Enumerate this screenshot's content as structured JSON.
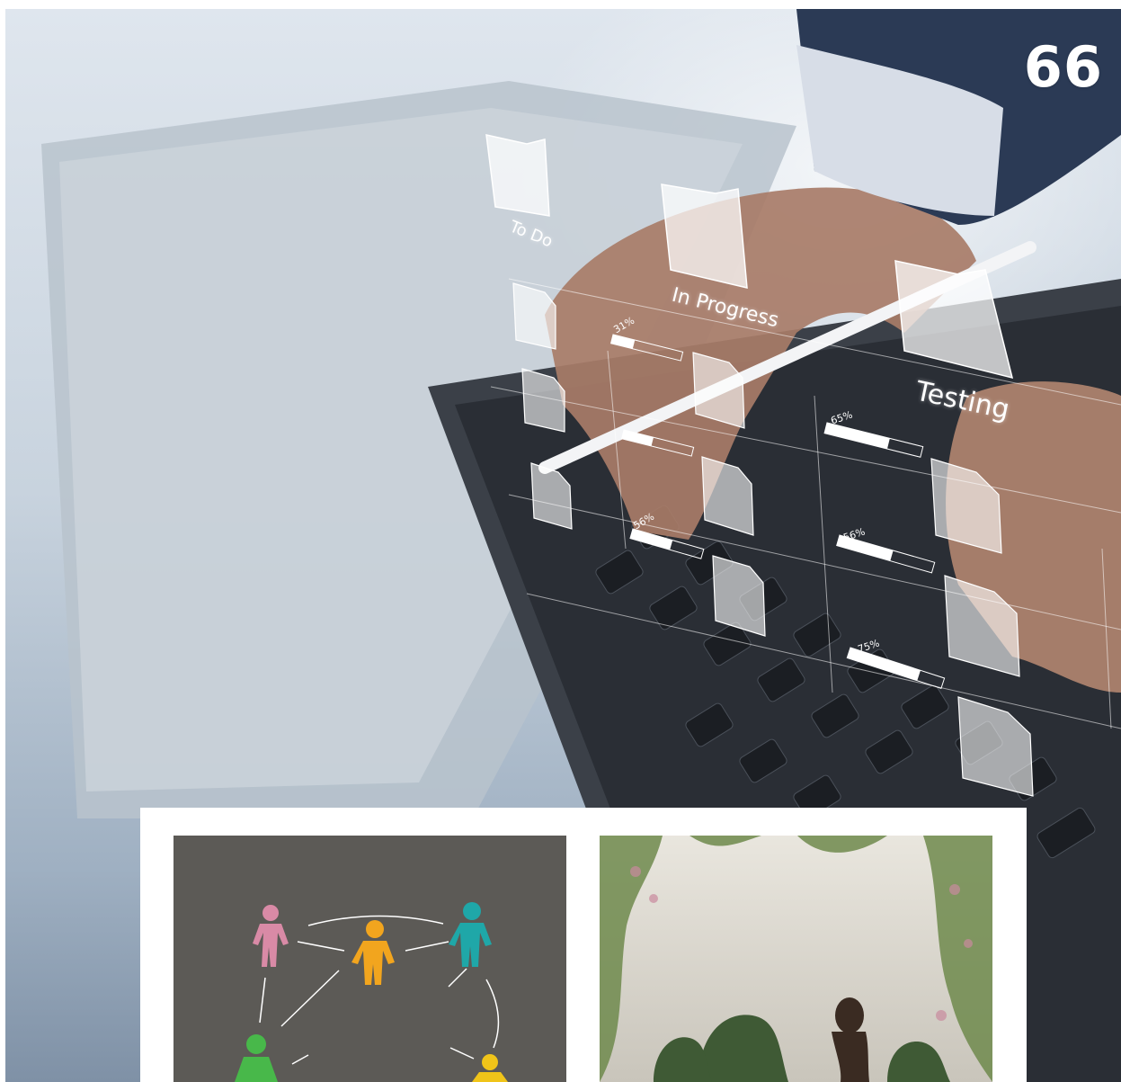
{
  "page_number": "66",
  "hero": {
    "columns": [
      {
        "label": "To Do"
      },
      {
        "label": "In Progress"
      },
      {
        "label": "Testing"
      }
    ],
    "progress": [
      {
        "label": "31%",
        "value": 0.31
      },
      {
        "label": "65%",
        "value": 0.65
      },
      {
        "label": "56%",
        "value": 0.56
      },
      {
        "label": "56%",
        "value": 0.56
      },
      {
        "label": "75%",
        "value": 0.75
      }
    ]
  },
  "colors": {
    "figure_pink": "#d98aa6",
    "figure_orange": "#f2a51e",
    "figure_teal": "#1fa7a8",
    "figure_green": "#48b84a",
    "figure_yellow": "#f0c419",
    "board_gray": "#5c5a56"
  }
}
